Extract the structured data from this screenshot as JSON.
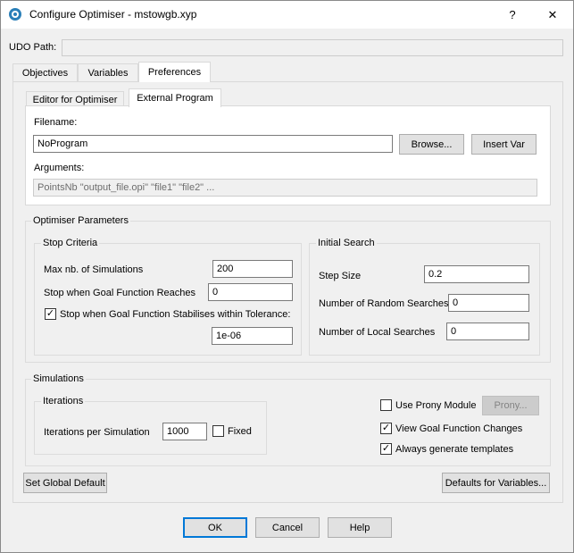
{
  "window": {
    "title": "Configure Optimiser - mstowgb.xyp",
    "help_glyph": "?",
    "close_glyph": "✕"
  },
  "udo_path": {
    "label": "UDO Path:",
    "value": ""
  },
  "tabs": [
    {
      "label": "Objectives"
    },
    {
      "label": "Variables"
    },
    {
      "label": "Preferences"
    }
  ],
  "subtabs": [
    {
      "label": "Editor for Optimiser"
    },
    {
      "label": "External Program"
    }
  ],
  "external_program": {
    "filename_label": "Filename:",
    "filename_value": "NoProgram",
    "browse_label": "Browse...",
    "insert_var_label": "Insert Var",
    "arguments_label": "Arguments:",
    "arguments_value": "PointsNb \"output_file.opi\" \"file1\" \"file2\" ..."
  },
  "optimiser_parameters": {
    "title": "Optimiser Parameters",
    "stop_criteria": {
      "title": "Stop Criteria",
      "max_sim_label": "Max nb. of Simulations",
      "max_sim_value": "200",
      "goal_reach_label": "Stop when Goal Function Reaches",
      "goal_reach_value": "0",
      "stabilise_label": "Stop when Goal Function Stabilises within Tolerance:",
      "stabilise_checked": true,
      "tolerance_value": "1e-06"
    },
    "initial_search": {
      "title": "Initial Search",
      "step_size_label": "Step Size",
      "step_size_value": "0.2",
      "random_label": "Number of Random Searches",
      "random_value": "0",
      "local_label": "Number of Local Searches",
      "local_value": "0"
    }
  },
  "simulations": {
    "title": "Simulations",
    "iterations_title": "Iterations",
    "iter_label": "Iterations per Simulation",
    "iter_value": "1000",
    "fixed_label": "Fixed",
    "fixed_checked": false,
    "prony_label": "Use Prony Module",
    "prony_checked": false,
    "prony_button": "Prony...",
    "view_goal_label": "View Goal Function Changes",
    "view_goal_checked": true,
    "templates_label": "Always generate templates",
    "templates_checked": true
  },
  "buttons": {
    "set_global_default": "Set Global Default",
    "defaults_for_variables": "Defaults for Variables...",
    "ok": "OK",
    "cancel": "Cancel",
    "help": "Help"
  },
  "check_glyph": "✓",
  "colors": {
    "accent": "#0078d7",
    "window_bg": "#f0f0f0"
  },
  "icons": {
    "app": "app-logo-icon"
  }
}
